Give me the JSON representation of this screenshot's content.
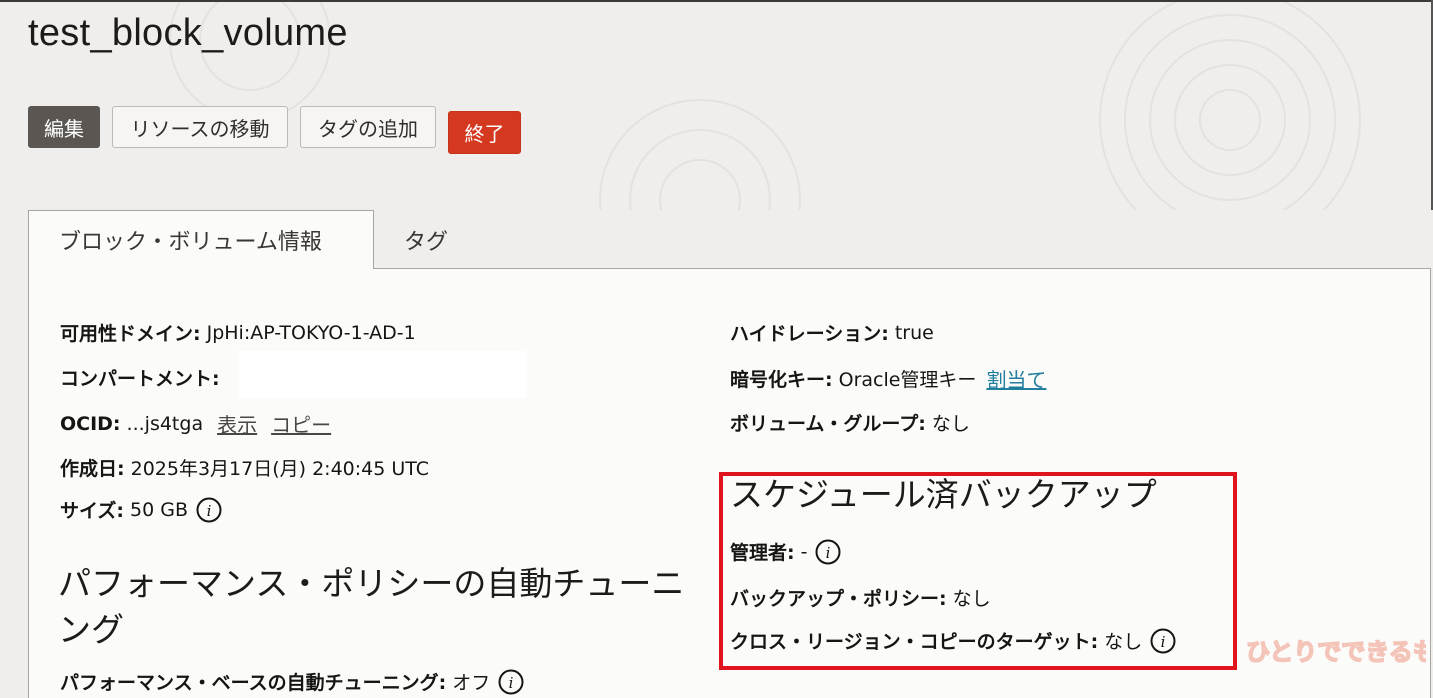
{
  "page": {
    "title": "test_block_volume"
  },
  "toolbar": {
    "edit_label": "編集",
    "move_label": "リソースの移動",
    "add_tag_label": "タグの追加",
    "terminate_label": "終了"
  },
  "tabs": [
    {
      "label": "ブロック・ボリューム情報",
      "active": true
    },
    {
      "label": "タグ",
      "active": false
    }
  ],
  "left": {
    "availability_domain": {
      "key": "可用性ドメイン:",
      "value": "JpHi:AP-TOKYO-1-AD-1"
    },
    "compartment": {
      "key": "コンパートメント:",
      "value": ""
    },
    "ocid": {
      "key": "OCID:",
      "value": "...js4tga",
      "show_link": "表示",
      "copy_link": "コピー"
    },
    "created": {
      "key": "作成日:",
      "value": "2025年3月17日(月) 2:40:45 UTC"
    },
    "size": {
      "key": "サイズ:",
      "value": "50 GB"
    },
    "perf_title": "パフォーマンス・ポリシーの自動チューニング",
    "perf_row": {
      "key": "パフォーマンス・ベースの自動チューニング:",
      "value": "オフ"
    }
  },
  "right": {
    "hydration": {
      "key": "ハイドレーション:",
      "value": "true"
    },
    "encryption": {
      "key": "暗号化キー:",
      "value": "Oracle管理キー",
      "link": "割当て"
    },
    "volume_group": {
      "key": "ボリューム・グループ:",
      "value": "なし"
    },
    "backup_title": "スケジュール済バックアップ",
    "admin": {
      "key": "管理者:",
      "value": "-"
    },
    "backup_policy": {
      "key": "バックアップ・ポリシー:",
      "value": "なし"
    },
    "cross_region": {
      "key": "クロス・リージョン・コピーのターゲット:",
      "value": "なし"
    }
  },
  "watermark": {
    "text": "ひとりでできるもん"
  },
  "colors": {
    "primary_button": "#5b5652",
    "danger_button": "#d4391f",
    "link_blue": "#227e9e",
    "highlight_box": "#e0141d"
  }
}
